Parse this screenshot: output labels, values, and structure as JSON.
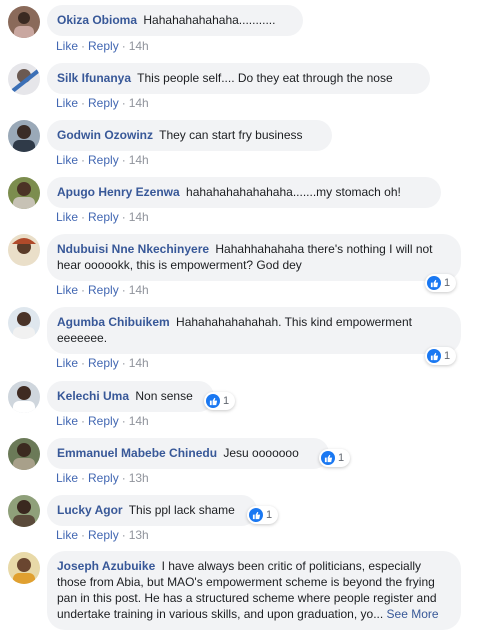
{
  "actions": {
    "like": "Like",
    "reply": "Reply",
    "separator": "·"
  },
  "colors": {
    "link": "#385898",
    "bubble": "#f2f3f5",
    "like_blue": "#1a78f2"
  },
  "comments": [
    {
      "author": "Okiza Obioma",
      "text": "Hahahahahahaha...........",
      "time": "14h"
    },
    {
      "author": "Silk Ifunanya",
      "text": "This people self.... Do they eat through the nose",
      "time": "14h"
    },
    {
      "author": "Godwin Ozowinz",
      "text": "They can start fry business",
      "time": "14h"
    },
    {
      "author": "Apugo Henry Ezenwa",
      "text": "hahahahahahahaha.......my stomach oh!",
      "time": "14h"
    },
    {
      "author": "Ndubuisi Nne Nkechinyere",
      "text": "Hahahhahahaha there's nothing I will not hear oooookk, this is empowerment? God dey",
      "time": "14h",
      "reactions": {
        "icon": "like-icon",
        "count": "1"
      }
    },
    {
      "author": "Agumba Chibuikem",
      "text": "Hahahahahahahah. This kind empowerment eeeeeee.",
      "time": "14h",
      "reactions": {
        "icon": "like-icon",
        "count": "1"
      }
    },
    {
      "author": "Kelechi Uma",
      "text": "Non sense",
      "time": "14h",
      "reactions": {
        "icon": "like-icon",
        "count": "1"
      }
    },
    {
      "author": "Emmanuel Mabebe Chinedu",
      "text": "Jesu ooooooo",
      "time": "13h",
      "reactions": {
        "icon": "like-icon",
        "count": "1"
      }
    },
    {
      "author": "Lucky Agor",
      "text": "This ppl lack shame",
      "time": "13h",
      "reactions": {
        "icon": "like-icon",
        "count": "1"
      }
    },
    {
      "author": "Joseph Azubuike",
      "text": "I have always been critic of politicians, especially those from Abia, but MAO's empowerment scheme is beyond the frying pan in this post. He has a structured scheme where people register and undertake training in various skills, and upon graduation, yo...",
      "see_more": "See More"
    }
  ]
}
